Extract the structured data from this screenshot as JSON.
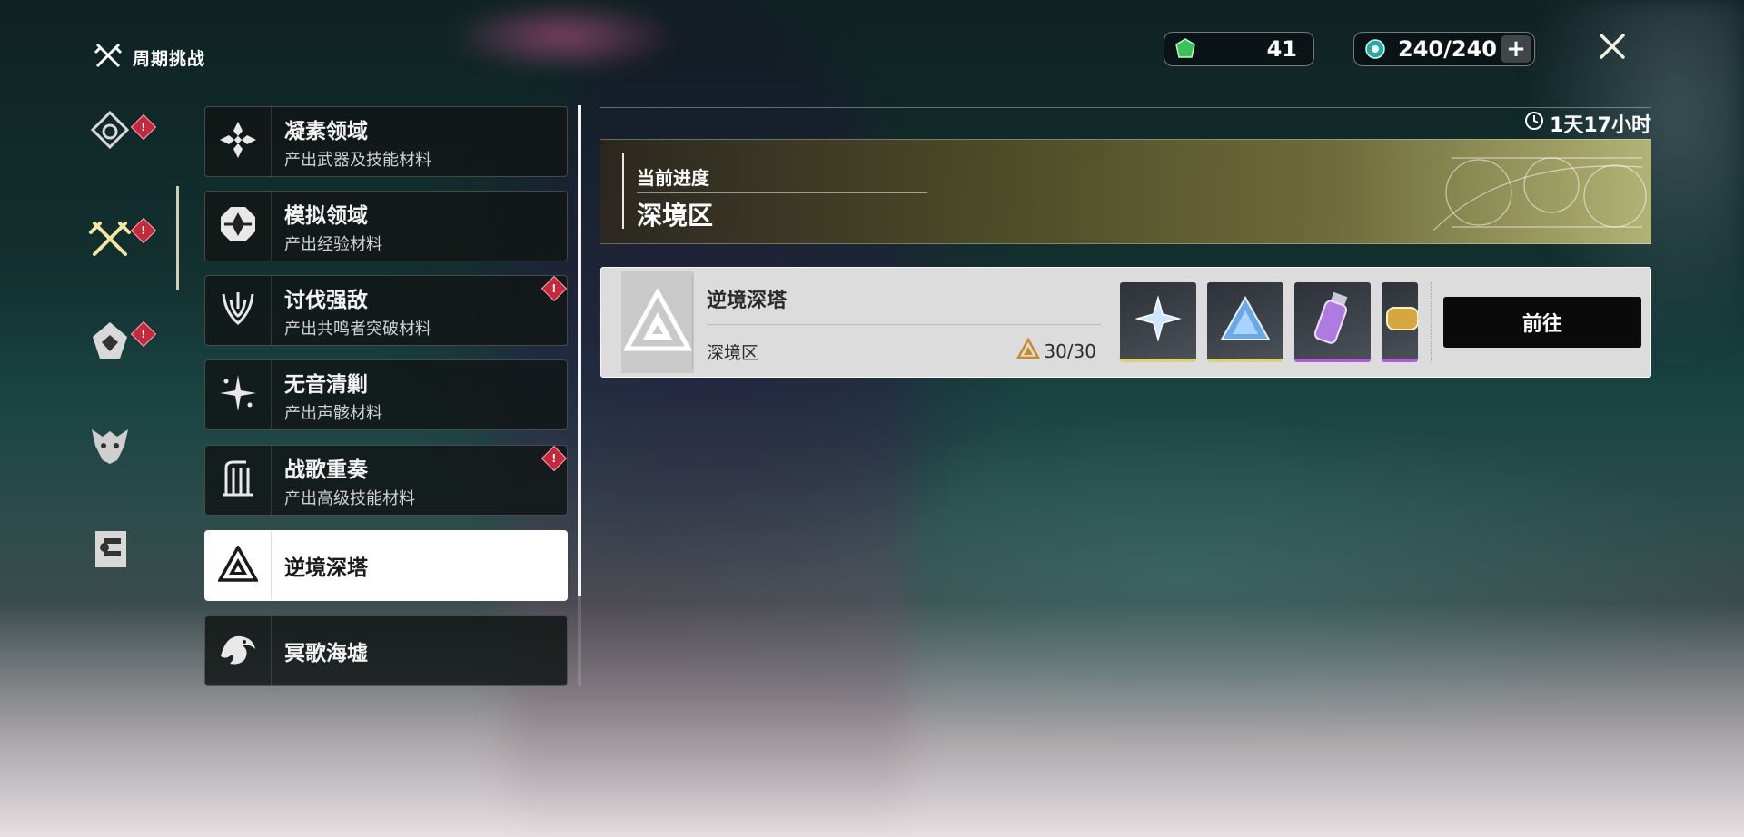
{
  "header": {
    "mode_title": "周期挑战",
    "resource_primary": {
      "icon": "green-crystal-icon",
      "value": "41"
    },
    "resource_stamina": {
      "icon": "waveplate-icon",
      "value": "240/240",
      "add_button": "+"
    },
    "close_icon": "close-icon"
  },
  "rail": {
    "items": [
      {
        "icon": "diamond-ring-icon",
        "alert": "!"
      },
      {
        "icon": "crossed-swords-icon",
        "alert": "!",
        "active": true
      },
      {
        "icon": "shield-bird-icon",
        "alert": "!"
      },
      {
        "icon": "dragon-mask-icon"
      },
      {
        "icon": "echo-book-icon"
      }
    ]
  },
  "categories": [
    {
      "name": "凝素领域",
      "sub": "产出武器及技能材料",
      "icon": "crystal-cluster-icon",
      "alert": ""
    },
    {
      "name": "模拟领域",
      "sub": "产出经验材料",
      "icon": "octagon-flower-icon",
      "alert": ""
    },
    {
      "name": "讨伐强敌",
      "sub": "产出共鸣者突破材料",
      "icon": "horned-crest-icon",
      "alert": "!"
    },
    {
      "name": "无音清剿",
      "sub": "产出声骸材料",
      "icon": "sparkle-icon",
      "alert": ""
    },
    {
      "name": "战歌重奏",
      "sub": "产出高级技能材料",
      "icon": "harp-icon",
      "alert": "!"
    },
    {
      "name": "逆境深塔",
      "sub": "",
      "icon": "triangle-tower-icon",
      "alert": "",
      "active": true
    },
    {
      "name": "冥歌海墟",
      "sub": "",
      "icon": "wave-beast-icon",
      "alert": ""
    }
  ],
  "panel": {
    "timer": "1天17小时",
    "progress_label": "当前进度",
    "progress_value": "深境区",
    "card": {
      "title": "逆境深塔",
      "zone": "深境区",
      "stars": "30/30",
      "rewards": [
        {
          "icon": "star-shard-icon",
          "rarity_color": "#d9d27a"
        },
        {
          "icon": "blue-prism-icon",
          "rarity_color": "#d9d27a"
        },
        {
          "icon": "purple-vial-icon",
          "rarity_color": "#b35ad6"
        },
        {
          "icon": "gold-capsule-icon",
          "rarity_color": "#b35ad6"
        }
      ],
      "go_button": "前往"
    }
  }
}
